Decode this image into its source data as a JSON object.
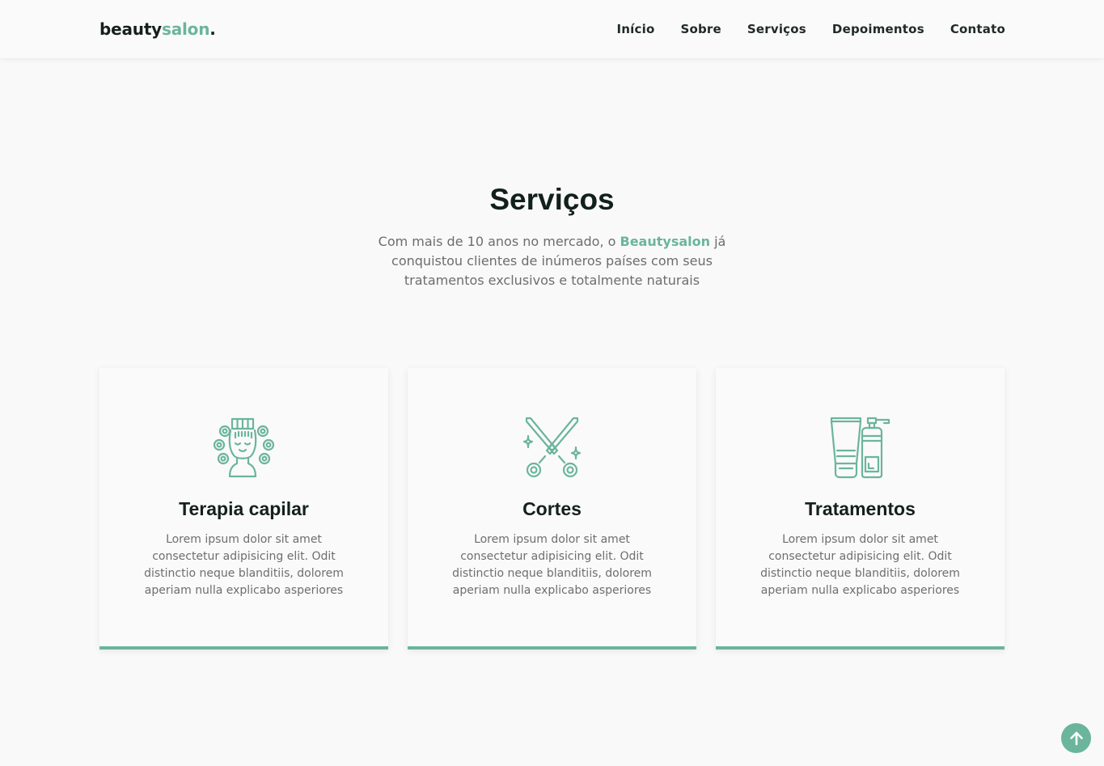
{
  "header": {
    "logo_main": "beauty",
    "logo_accent": "salon",
    "logo_dot": ".",
    "nav": [
      "Início",
      "Sobre",
      "Serviços",
      "Depoimentos",
      "Contato"
    ]
  },
  "services": {
    "title": "Serviços",
    "subtitle_line1_before": "Com mais de 10 anos no mercado, o ",
    "subtitle_brand": "Beautysalon",
    "subtitle_line1_after": " já",
    "subtitle_line2": "conquistou clientes de inúmeros países com seus",
    "subtitle_line3": "tratamentos exclusivos e totalmente naturais",
    "cards": [
      {
        "icon": "hair-curlers-icon",
        "title": "Terapia capilar",
        "lines": [
          "Lorem ipsum dolor sit amet",
          "consectetur adipisicing elit. Odit",
          "distinctio neque blanditiis, dolorem",
          "aperiam nulla explicabo asperiores"
        ]
      },
      {
        "icon": "scissors-icon",
        "title": "Cortes",
        "lines": [
          "Lorem ipsum dolor sit amet",
          "consectetur adipisicing elit. Odit",
          "distinctio neque blanditiis, dolorem",
          "aperiam nulla explicabo asperiores"
        ]
      },
      {
        "icon": "cosmetics-bottles-icon",
        "title": "Tratamentos",
        "lines": [
          "Lorem ipsum dolor sit amet",
          "consectetur adipisicing elit. Odit",
          "distinctio neque blanditiis, dolorem",
          "aperiam nulla explicabo asperiores"
        ]
      }
    ]
  },
  "back_to_top_icon": "arrow-up-icon",
  "colors": {
    "accent": "#6bb59c",
    "background": "#f9f9f9",
    "heading": "#12201b",
    "text": "#6e6e6e"
  }
}
